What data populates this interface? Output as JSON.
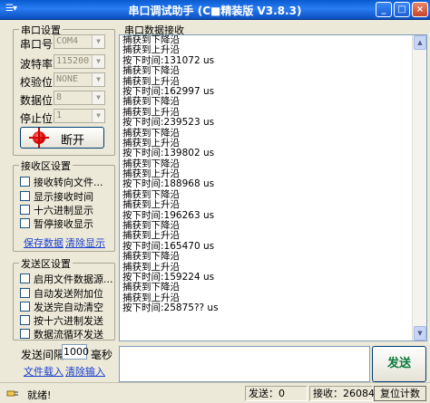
{
  "window": {
    "title": "串口调试助手 (C■精装版 V3.8.3)",
    "sysmenu_glyph": "☰▾",
    "minimize": "_",
    "maximize": "□",
    "close": "×"
  },
  "serial": {
    "group_title": "串口设置",
    "rows": [
      {
        "label": "串口号",
        "value": "COM4"
      },
      {
        "label": "波特率",
        "value": "115200"
      },
      {
        "label": "校验位",
        "value": "NONE"
      },
      {
        "label": "数据位",
        "value": "8"
      },
      {
        "label": "停止位",
        "value": "1"
      }
    ],
    "open_button": "断开"
  },
  "receive_settings": {
    "group_title": "接收区设置",
    "options": [
      "接收转向文件...",
      "显示接收时间",
      "十六进制显示",
      "暂停接收显示"
    ],
    "save_link": "保存数据",
    "clear_link": "清除显示"
  },
  "send_settings": {
    "group_title": "发送区设置",
    "options": [
      "启用文件数据源...",
      "自动发送附加位",
      "发送完自动清空",
      "按十六进制发送",
      "数据流循环发送"
    ],
    "interval_label": "发送间隔",
    "interval_value": "1000",
    "interval_unit": "毫秒",
    "load_file_link": "文件载入",
    "clear_input_link": "清除输入"
  },
  "receive": {
    "group_title": "串口数据接收",
    "lines": [
      "捕获到下降沿",
      "捕获到上升沿",
      "按下时间:131072 us",
      "捕获到下降沿",
      "捕获到上升沿",
      "按下时间:162997 us",
      "捕获到下降沿",
      "捕获到上升沿",
      "按下时间:239523 us",
      "捕获到下降沿",
      "捕获到上升沿",
      "按下时间:139802 us",
      "捕获到下降沿",
      "捕获到上升沿",
      "按下时间:188968 us",
      "捕获到下降沿",
      "捕获到上升沿",
      "按下时间:196263 us",
      "捕获到下降沿",
      "捕获到上升沿",
      "按下时间:165470 us",
      "捕获到下降沿",
      "捕获到上升沿",
      "按下时间:159224 us",
      "捕获到下降沿",
      "捕获到上升沿",
      "按下时间:25875?? us"
    ]
  },
  "send_button": "发送",
  "status": {
    "ready": "就绪!",
    "sent": "发送：0",
    "received": "接收：26084",
    "reset_button": "复位计数"
  }
}
